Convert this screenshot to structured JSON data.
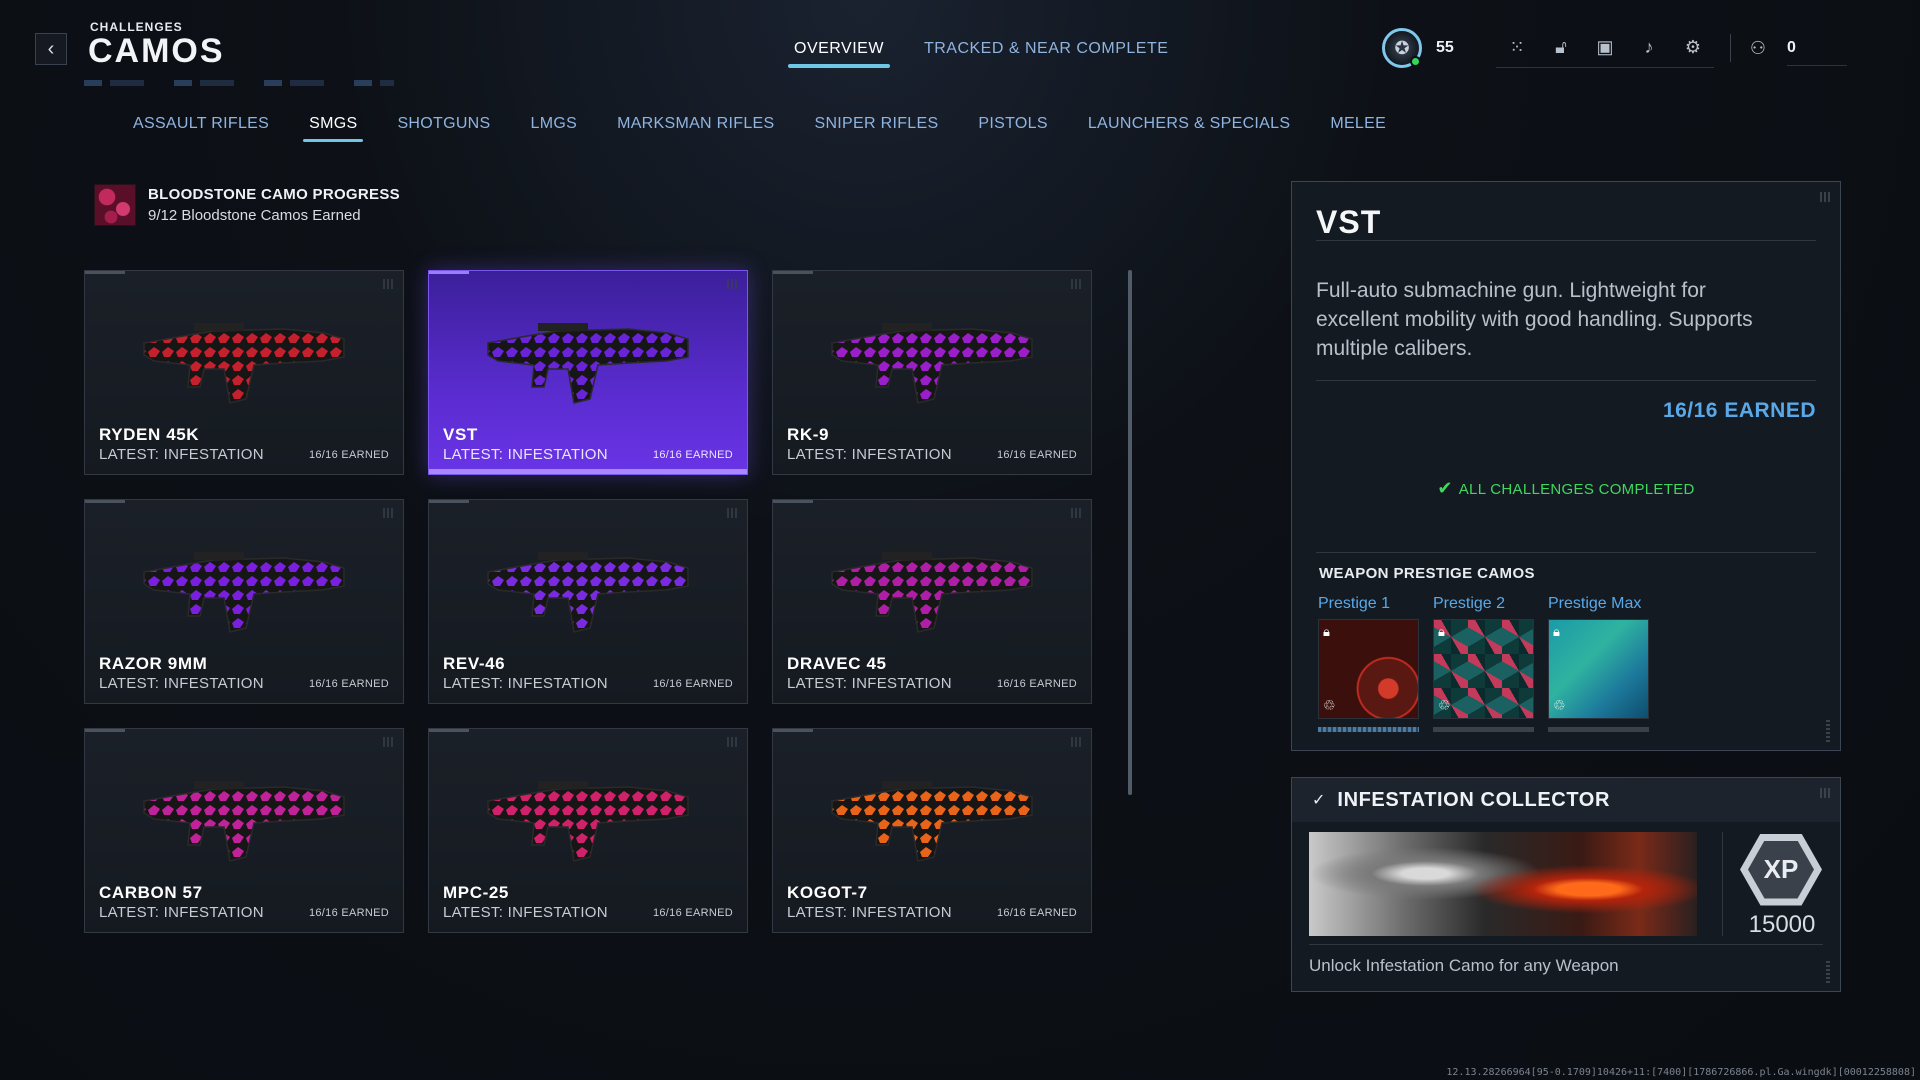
{
  "header": {
    "back_icon": "chevron-left-icon",
    "subtitle": "CHALLENGES",
    "title": "CAMOS",
    "tabs": [
      {
        "label": "OVERVIEW",
        "active": true
      },
      {
        "label": "TRACKED & NEAR COMPLETE",
        "active": false
      }
    ]
  },
  "hud": {
    "rank": "55",
    "online_color": "#36d65a",
    "icons": [
      "grid-dots-icon",
      "unlock-icon",
      "camera-icon",
      "bell-icon",
      "gear-icon"
    ],
    "party_icon": "party-icon",
    "party_count": "0"
  },
  "categories": [
    {
      "label": "ASSAULT RIFLES",
      "active": false
    },
    {
      "label": "SMGS",
      "active": true
    },
    {
      "label": "SHOTGUNS",
      "active": false
    },
    {
      "label": "LMGS",
      "active": false
    },
    {
      "label": "MARKSMAN RIFLES",
      "active": false
    },
    {
      "label": "SNIPER RIFLES",
      "active": false
    },
    {
      "label": "PISTOLS",
      "active": false
    },
    {
      "label": "LAUNCHERS & SPECIALS",
      "active": false
    },
    {
      "label": "MELEE",
      "active": false
    }
  ],
  "progress": {
    "title": "BLOODSTONE CAMO PROGRESS",
    "subtitle": "9/12 Bloodstone Camos Earned"
  },
  "weapons": [
    {
      "name": "RYDEN 45K",
      "latest": "LATEST: INFESTATION",
      "earned": "16/16 EARNED",
      "camo_color": "#c4202e",
      "selected": false
    },
    {
      "name": "VST",
      "latest": "LATEST: INFESTATION",
      "earned": "16/16 EARNED",
      "camo_color": "#6a24d8",
      "selected": true
    },
    {
      "name": "RK-9",
      "latest": "LATEST: INFESTATION",
      "earned": "16/16 EARNED",
      "camo_color": "#9a1fc8",
      "selected": false
    },
    {
      "name": "RAZOR 9MM",
      "latest": "LATEST: INFESTATION",
      "earned": "16/16 EARNED",
      "camo_color": "#7a1fe0",
      "selected": false
    },
    {
      "name": "REV-46",
      "latest": "LATEST: INFESTATION",
      "earned": "16/16 EARNED",
      "camo_color": "#7a2ae0",
      "selected": false
    },
    {
      "name": "DRAVEC 45",
      "latest": "LATEST: INFESTATION",
      "earned": "16/16 EARNED",
      "camo_color": "#b01ea8",
      "selected": false
    },
    {
      "name": "CARBON 57",
      "latest": "LATEST: INFESTATION",
      "earned": "16/16 EARNED",
      "camo_color": "#c0229a",
      "selected": false
    },
    {
      "name": "MPC-25",
      "latest": "LATEST: INFESTATION",
      "earned": "16/16 EARNED",
      "camo_color": "#d0226a",
      "selected": false
    },
    {
      "name": "KOGOT-7",
      "latest": "LATEST: INFESTATION",
      "earned": "16/16 EARNED",
      "camo_color": "#e8641a",
      "selected": false
    }
  ],
  "detail": {
    "name": "VST",
    "description": "Full-auto submachine gun. Lightweight for excellent mobility with good handling. Supports multiple calibers.",
    "earned": "16/16 EARNED",
    "complete": "ALL CHALLENGES COMPLETED",
    "prestige_title": "WEAPON PRESTIGE CAMOS",
    "prestige": [
      {
        "label": "Prestige 1",
        "locked": true,
        "progress": 1.0
      },
      {
        "label": "Prestige 2",
        "locked": true,
        "progress": 0
      },
      {
        "label": "Prestige Max",
        "locked": true,
        "progress": 0
      }
    ]
  },
  "reward": {
    "title": "INFESTATION COLLECTOR",
    "xp_label": "XP",
    "xp_amount": "15000",
    "description": "Unlock Infestation Camo for any Weapon"
  },
  "build_info": "12.13.28266964[95-0.1709]10426+11:[7400][1786726866.pl.Ga.wingdk][00012258808]"
}
